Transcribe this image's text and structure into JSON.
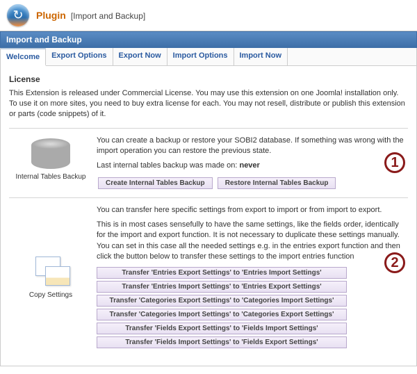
{
  "header": {
    "title": "Plugin",
    "sub": "[Import and Backup]"
  },
  "section_bar": "Import and Backup",
  "tabs": [
    {
      "label": "Welcome",
      "active": true
    },
    {
      "label": "Export Options",
      "active": false
    },
    {
      "label": "Export Now",
      "active": false
    },
    {
      "label": "Import Options",
      "active": false
    },
    {
      "label": "Import Now",
      "active": false
    }
  ],
  "license": {
    "title": "License",
    "text": "This Extension is released under Commercial License. You may use this extension on one Joomla! installation only. To use it on more sites, you need to buy extra license for each. You may not resell, distribute or publish this extension or parts (code snippets) of it."
  },
  "backup": {
    "label": "Internal Tables Backup",
    "desc": "You can create a backup or restore your SOBI2 database. If something was wrong with the import operation you can restore the previous state.",
    "last_prefix": "Last internal tables backup was made on: ",
    "last_value": "never",
    "btn_create": "Create Internal Tables Backup",
    "btn_restore": "Restore Internal Tables Backup",
    "annotation": "1"
  },
  "copy": {
    "label": "Copy Settings",
    "p1": "You can transfer here specific settings from export to import or from import to export.",
    "p2": "This is in most cases sensefully to have the same settings, like the fields order, identically for the import and export function. It is not necessary to duplicate these settings manually. You can set in this case all the needed settings e.g. in the entries export function and then click the button below to transfer these settings to the import entries function",
    "annotation": "2",
    "buttons": [
      "Transfer 'Entries Export Settings' to 'Entries Import Settings'",
      "Transfer 'Entries Import Settings' to 'Entries Export Settings'",
      "Transfer 'Categories Export Settings' to 'Categories Import Settings'",
      "Transfer 'Categories Import Settings' to 'Categories Export Settings'",
      "Transfer 'Fields Export Settings' to 'Fields Import Settings'",
      "Transfer 'Fields Import Settings' to 'Fields Export Settings'"
    ]
  }
}
